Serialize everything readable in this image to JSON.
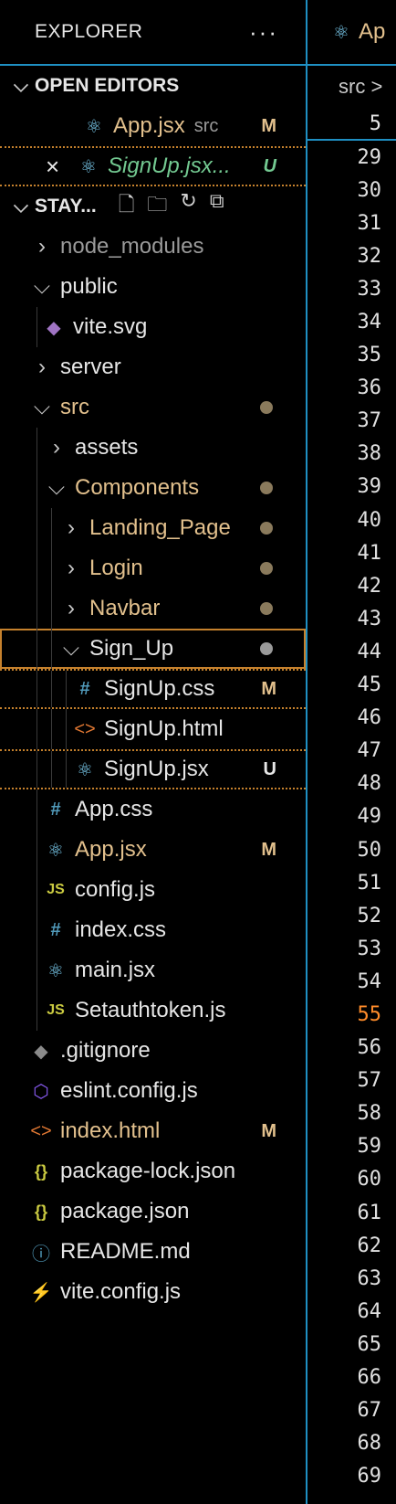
{
  "explorer": {
    "title": "EXPLORER",
    "more": "···"
  },
  "open_editors": {
    "label": "OPEN EDITORS",
    "items": [
      {
        "name": "App.jsx",
        "desc": "src",
        "badge": "M"
      },
      {
        "name": "SignUp.jsx...",
        "badge": "U",
        "close": "×"
      }
    ]
  },
  "workspace": {
    "label": "STAY..."
  },
  "tree": {
    "node_modules": "node_modules",
    "public": "public",
    "vite_svg": "vite.svg",
    "server": "server",
    "src": "src",
    "assets": "assets",
    "components": "Components",
    "landing": "Landing_Page",
    "login": "Login",
    "navbar": "Navbar",
    "sign_up": "Sign_Up",
    "signup_css": {
      "name": "SignUp.css",
      "badge": "M"
    },
    "signup_html": {
      "name": "SignUp.html"
    },
    "signup_jsx": {
      "name": "SignUp.jsx",
      "badge": "U"
    },
    "app_css": "App.css",
    "app_jsx": {
      "name": "App.jsx",
      "badge": "M"
    },
    "config_js": "config.js",
    "index_css": "index.css",
    "main_jsx": "main.jsx",
    "setauth": "Setauthtoken.js",
    "gitignore": ".gitignore",
    "eslint": "eslint.config.js",
    "index_html": {
      "name": "index.html",
      "badge": "M"
    },
    "pkg_lock": "package-lock.json",
    "pkg": "package.json",
    "readme": "README.md",
    "vite_config": "vite.config.js"
  },
  "editor": {
    "tab": "Ap",
    "breadcrumb": "src >",
    "sticky_line": "5",
    "lines": [
      "29",
      "30",
      "31",
      "32",
      "33",
      "34",
      "35",
      "36",
      "37",
      "38",
      "39",
      "40",
      "41",
      "42",
      "43",
      "44",
      "45",
      "46",
      "47",
      "48",
      "49",
      "50",
      "51",
      "52",
      "53",
      "54",
      "55",
      "56",
      "57",
      "58",
      "59",
      "60",
      "61",
      "62",
      "63",
      "64",
      "65",
      "66",
      "67",
      "68",
      "69"
    ],
    "active_line": "55"
  },
  "colors": {
    "accent": "#1f8fc2",
    "modified": "#e2c08d",
    "untracked": "#73c991",
    "selection": "#c5812d"
  }
}
